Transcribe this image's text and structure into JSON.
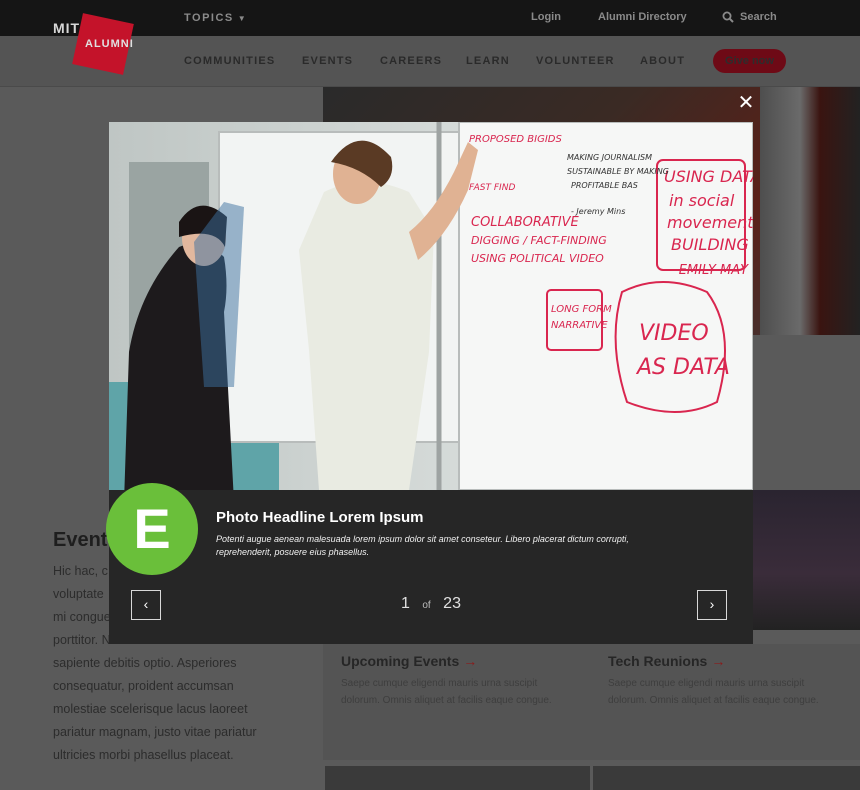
{
  "header": {
    "logo_top": "MIT",
    "logo_bottom": "ALUMNI",
    "topics_label": "TOPICS",
    "login_label": "Login",
    "directory_label": "Alumni Directory",
    "search_label": "Search"
  },
  "nav": {
    "items": [
      "COMMUNITIES",
      "EVENTS",
      "CAREERS",
      "LEARN",
      "VOLUNTEER",
      "ABOUT"
    ],
    "give_label": "Give now"
  },
  "background": {
    "events_heading": "Events",
    "events_paragraph": "Hic hac, c\nvoluptate\nmi congue\nporttitor. N\nsapiente debitis optio. Asperiores\nconsequatur, proident accumsan\nmolestiae scelerisque lacus laoreet\npariatur magnam, justo vitae pariatur\nultricies morbi phasellus placeat.",
    "cards": [
      {
        "title": "Upcoming Events",
        "desc": "Saepe cumque eligendi mauris urna suscipit dolorum. Omnis aliquet at facilis eaque congue."
      },
      {
        "title": "Tech Reunions",
        "desc": "Saepe cumque eligendi mauris urna suscipit dolorum. Omnis aliquet at facilis eaque congue."
      }
    ]
  },
  "lightbox": {
    "badge_letter": "E",
    "photo_title": "Photo Headline Lorem Ipsum",
    "photo_desc": "Potenti augue aenean malesuada lorem ipsum dolor sit amet conseteur. Libero placerat dictum corrupti, reprehenderit, posuere eius phasellus.",
    "current": "1",
    "of_label": "of",
    "total": "23",
    "prev_glyph": "‹",
    "next_glyph": "›",
    "close_glyph": "✕",
    "whiteboard": {
      "left_notes": [
        "PROPOSED BIGIDS",
        "FAST FIND",
        "COLLABORATIVE",
        "DIGGING / FACT-FINDING",
        "USING POLITICAL VIDEO"
      ],
      "mid_notes": [
        "MAKING JOURNALISM",
        "SUSTAINABLE BY MAKING",
        "PROFITABLE BAS",
        "- Jeremy Mins"
      ],
      "boxed_top": [
        "USING DATA",
        "in social",
        "movement",
        "BUILDING",
        "-EMILY MAY"
      ],
      "long_form": [
        "LONG FORM",
        "NARRATIVE"
      ],
      "video_data": [
        "VIDEO",
        "AS DATA"
      ]
    }
  },
  "colors": {
    "badge": "#6abf3a",
    "brand_red": "#c4132a",
    "overlay": "#262626",
    "marker": "#d9264f"
  }
}
